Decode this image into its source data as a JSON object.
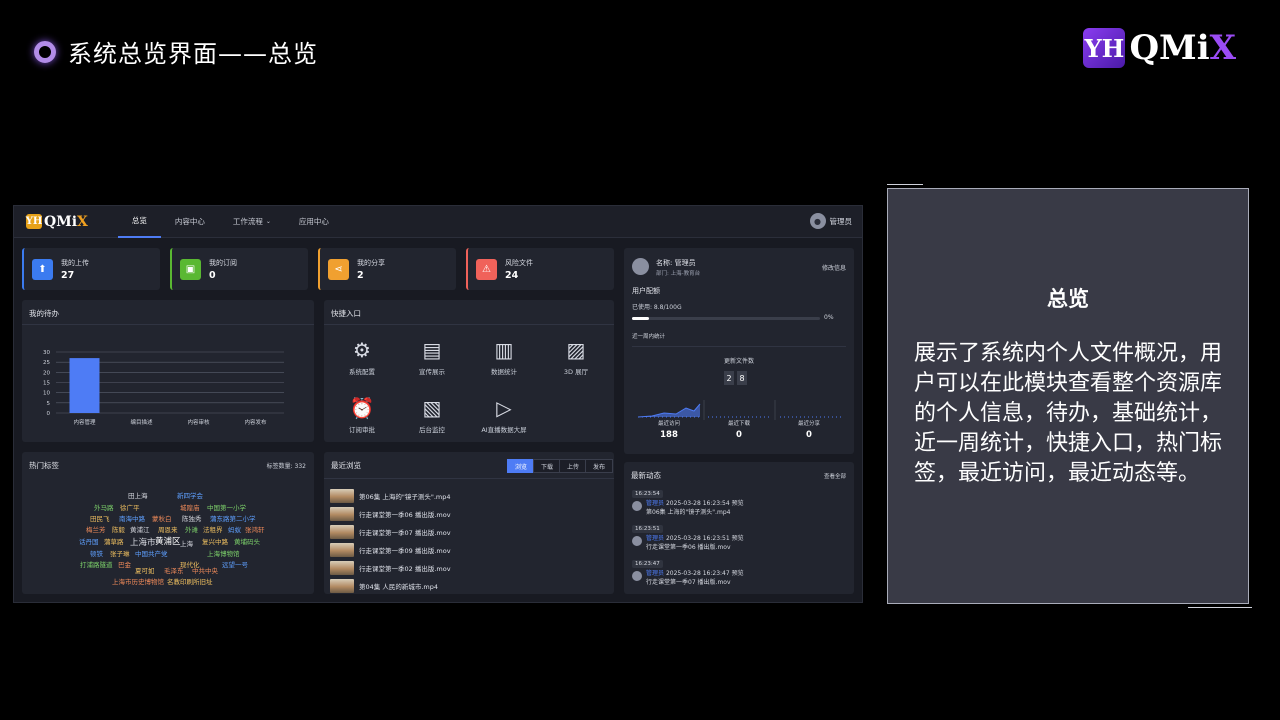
{
  "slide": {
    "title": "系统总览界面——总览",
    "brand": {
      "mark": "YH",
      "text": "QMi",
      "x": "X"
    }
  },
  "app": {
    "logo": {
      "mark": "YH",
      "text": "QMi",
      "x": "X"
    },
    "nav": [
      "总览",
      "内容中心",
      "工作流程",
      "应用中心"
    ],
    "user": "管理员"
  },
  "stats": [
    {
      "label": "我的上传",
      "value": "27",
      "color": "#3b7bf0",
      "icon": "upload-icon"
    },
    {
      "label": "我的订阅",
      "value": "0",
      "color": "#5ab832",
      "icon": "subscribe-icon"
    },
    {
      "label": "我的分享",
      "value": "2",
      "color": "#f0a030",
      "icon": "share-icon"
    },
    {
      "label": "风险文件",
      "value": "24",
      "color": "#f0625a",
      "icon": "risk-file-icon"
    }
  ],
  "todo": {
    "title": "我的待办",
    "chart_data": {
      "type": "bar",
      "categories": [
        "内容管理",
        "编目描述",
        "内容审核",
        "内容发布"
      ],
      "values": [
        27,
        0,
        0,
        0
      ],
      "ylim": [
        0,
        30
      ],
      "yticks": [
        0,
        5,
        10,
        15,
        20,
        25,
        30
      ],
      "color": "#4e7cf5",
      "grid": true
    }
  },
  "quick": {
    "title": "快捷入口",
    "items": [
      {
        "label": "系统配置",
        "icon": "user-settings-icon",
        "glyph": "⚙"
      },
      {
        "label": "宣传展示",
        "icon": "display-icon",
        "glyph": "▤"
      },
      {
        "label": "数据统计",
        "icon": "bar-chart-icon",
        "glyph": "▥"
      },
      {
        "label": "3D 展厅",
        "icon": "image-icon",
        "glyph": "▨"
      },
      {
        "label": "订阅审批",
        "icon": "alarm-icon",
        "glyph": "⏰"
      },
      {
        "label": "后台监控",
        "icon": "document-search-icon",
        "glyph": "▧"
      },
      {
        "label": "AI直播数据大屏",
        "icon": "play-screen-icon",
        "glyph": "▷"
      }
    ]
  },
  "profile": {
    "name": "名称: 管理员",
    "dept": "部门: 上海-教育台",
    "edit": "修改信息",
    "quota_title": "用户配额",
    "used": "已使用: 8.8/100G",
    "percent_label": "0%",
    "percent": 0.09,
    "weekly_title": "近一周内统计",
    "update_title": "更新文件数",
    "update_digits": [
      "2",
      "8"
    ],
    "metrics": [
      {
        "label": "最近访问",
        "value": "188"
      },
      {
        "label": "最近下载",
        "value": "0"
      },
      {
        "label": "最近分享",
        "value": "0"
      }
    ]
  },
  "tags": {
    "title": "热门标签",
    "count": "标签数量: 332",
    "items": [
      {
        "text": "田上海",
        "color": "#d7d9e0"
      },
      {
        "text": "新四学会",
        "color": "#5fa0ff"
      },
      {
        "text": "外马路",
        "color": "#7ed36b"
      },
      {
        "text": "徐广平",
        "color": "#f0c060"
      },
      {
        "text": "城隍庙",
        "color": "#f08b5a"
      },
      {
        "text": "中国第一小学",
        "color": "#7ed36b"
      },
      {
        "text": "田民飞",
        "color": "#f0c060"
      },
      {
        "text": "南海中路",
        "color": "#5fa0ff"
      },
      {
        "text": "蒙秋白",
        "color": "#f08b5a"
      },
      {
        "text": "陈独秀",
        "color": "#d7d9e0"
      },
      {
        "text": "蒲东路第二小学",
        "color": "#5fa0ff"
      },
      {
        "text": "梅兰芳",
        "color": "#f08b5a"
      },
      {
        "text": "陈毅",
        "color": "#f0c060"
      },
      {
        "text": "黄浦江",
        "color": "#d7d9e0"
      },
      {
        "text": "周恩来",
        "color": "#f0c060"
      },
      {
        "text": "外滩",
        "color": "#7ed36b"
      },
      {
        "text": "法租界",
        "color": "#f0c060"
      },
      {
        "text": "蚂蚁",
        "color": "#5fa0ff"
      },
      {
        "text": "张鸿轩",
        "color": "#f08b5a"
      },
      {
        "text": "话丹国",
        "color": "#5fa0ff"
      },
      {
        "text": "蒲草路",
        "color": "#f0c060"
      },
      {
        "text": "上海市",
        "color": "#d7d9e0"
      },
      {
        "text": "黄浦区",
        "color": "#ffffff"
      },
      {
        "text": "上海",
        "color": "#d7d9e0"
      },
      {
        "text": "复兴中路",
        "color": "#f0c060"
      },
      {
        "text": "黄埔码头",
        "color": "#7ed36b"
      },
      {
        "text": "顿铁",
        "color": "#5fa0ff"
      },
      {
        "text": "张子琳",
        "color": "#f0c060"
      },
      {
        "text": "中国共产党",
        "color": "#5fa0ff"
      },
      {
        "text": "上海博物馆",
        "color": "#7ed36b"
      },
      {
        "text": "打浦路隧道",
        "color": "#7ed36b"
      },
      {
        "text": "巴金",
        "color": "#f08b5a"
      },
      {
        "text": "现代化",
        "color": "#f0c060"
      },
      {
        "text": "远望一号",
        "color": "#5fa0ff"
      },
      {
        "text": "夏可如",
        "color": "#f0c060"
      },
      {
        "text": "毛泽东",
        "color": "#f08b5a"
      },
      {
        "text": "中共中央",
        "color": "#f08b5a"
      },
      {
        "text": "上海市历史博物馆",
        "color": "#f08b5a"
      },
      {
        "text": "名教印刷所旧址",
        "color": "#f0c060"
      }
    ]
  },
  "recent": {
    "title": "最近浏览",
    "tabs": [
      "浏览",
      "下载",
      "上传",
      "发布"
    ],
    "items": [
      "第06集 上海的\"镜子测头\".mp4",
      "行走课堂第一季06 播出版.mov",
      "行走课堂第一季07 播出版.mov",
      "行走课堂第一季09 播出版.mov",
      "行走课堂第一季02 播出版.mov",
      "第04集 人民的新城市.mp4"
    ]
  },
  "activity": {
    "title": "最新动态",
    "view_all": "查看全部",
    "items": [
      {
        "time": "16:23:54",
        "user": "管理员",
        "line1": "2025-03-28 16:23:54 预览",
        "line2": "第06集 上海的\"镜子测头\".mp4"
      },
      {
        "time": "16:23:51",
        "user": "管理员",
        "line1": "2025-03-28 16:23:51 预览",
        "line2": "行走课堂第一季06 播出版.mov"
      },
      {
        "time": "16:23:47",
        "user": "管理员",
        "line1": "2025-03-28 16:23:47 预览",
        "line2": "行走课堂第一季07 播出版.mov"
      }
    ]
  },
  "description": {
    "title": "总览",
    "body": "展示了系统内个人文件概况，用户可以在此模块查看整个资源库的个人信息，待办，基础统计，近一周统计，快捷入口，热门标签，最近访问，最近动态等。"
  }
}
